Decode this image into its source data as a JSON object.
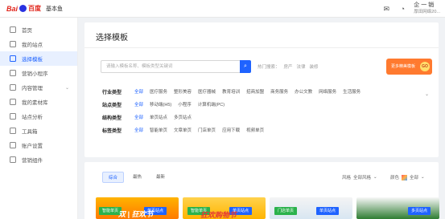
{
  "topbar": {
    "logo_brand": "Bai",
    "logo_du": "百度",
    "logo_name": "基本鱼",
    "user_name": "企 一 销",
    "user_org": "厚田网络20..."
  },
  "sidebar": {
    "items": [
      {
        "label": "首页"
      },
      {
        "label": "我的站点"
      },
      {
        "label": "选择模板"
      },
      {
        "label": "营销小程序"
      },
      {
        "label": "内容管理"
      },
      {
        "label": "我的素材库"
      },
      {
        "label": "站点分析"
      },
      {
        "label": "工具箱"
      },
      {
        "label": "账户设置"
      },
      {
        "label": "营销组件"
      }
    ]
  },
  "main": {
    "title": "选择模板",
    "search_placeholder": "请输入模板名称、模板类型关键词",
    "hot_label": "热门搜索：",
    "hot_keywords": [
      "房产",
      "法律",
      "装修"
    ],
    "promo_text": "更多精美模板",
    "promo_badge": "GO",
    "filters": [
      {
        "label": "行业类型",
        "options": [
          "全部",
          "医疗服务",
          "整形美容",
          "医疗器械",
          "教育培训",
          "招商加盟",
          "商务服务",
          "办公文教",
          "网络服务",
          "生活服务"
        ]
      },
      {
        "label": "站点类型",
        "options": [
          "全部",
          "移动端(H5)",
          "小程序",
          "计算机端(PC)"
        ]
      },
      {
        "label": "结构类型",
        "options": [
          "全部",
          "单页站点",
          "多页站点"
        ]
      },
      {
        "label": "标签类型",
        "options": [
          "全部",
          "智能单页",
          "文章单页",
          "门店单页",
          "应用下载",
          "视频单页"
        ]
      }
    ],
    "sort_tabs": [
      "综合",
      "最热",
      "最新"
    ],
    "style_label": "风格",
    "style_value": "全部风格",
    "color_label": "颜色",
    "color_value": "全部",
    "cards": [
      {
        "tag1": "智能单页",
        "tag2": "单页站点",
        "headline": "双 | 狂欢节"
      },
      {
        "tag1": "智能单页",
        "tag2": "单页站点",
        "headline": "狂欢购物节"
      },
      {
        "tag1": "门店单页",
        "tag2": "单页站点",
        "headline": ""
      },
      {
        "tag1": "多页站点",
        "tag2": "",
        "headline": ""
      }
    ]
  }
}
